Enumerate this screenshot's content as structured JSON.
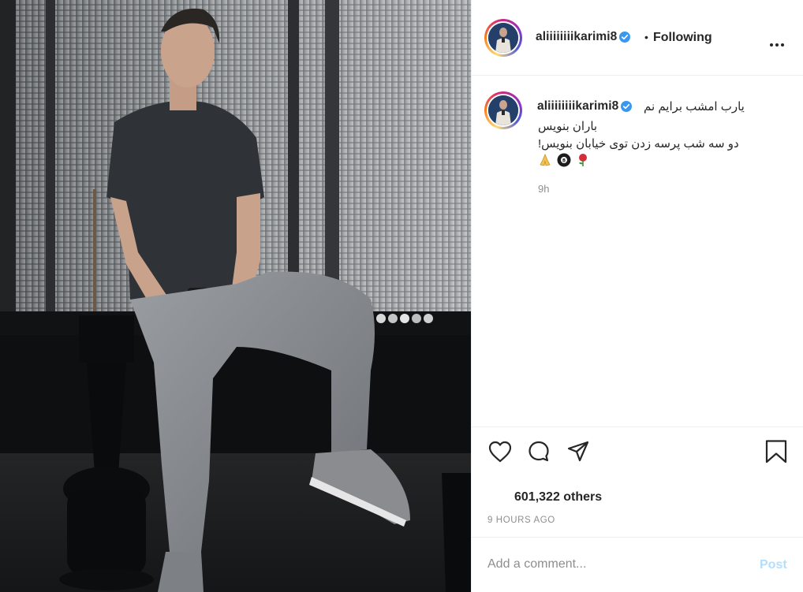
{
  "post": {
    "username": "aliiiiiiiikarimi8",
    "follow_status": "Following",
    "header_separator": "•",
    "caption_line1": "یارب امشب برایم نم",
    "caption_line2": "باران بنویس",
    "caption_line3": "!دو سه شب پرسه زدن توی خیابان بنویس",
    "caption_emojis": [
      "folded-hands",
      "pool-8-ball",
      "rose"
    ],
    "caption_time": "9h",
    "likes_text": "601,322 others",
    "posted_ago": "9 HOURS AGO"
  },
  "comment": {
    "placeholder": "Add a comment...",
    "post_label": "Post"
  },
  "colors": {
    "verified": "#3897f0",
    "post_button_disabled": "#b2dffc",
    "secondary_text": "#8e8e8e",
    "text": "#262626"
  },
  "icons": [
    "verified-badge-icon",
    "more-options-icon",
    "heart-icon",
    "comment-icon",
    "share-icon",
    "bookmark-icon"
  ]
}
